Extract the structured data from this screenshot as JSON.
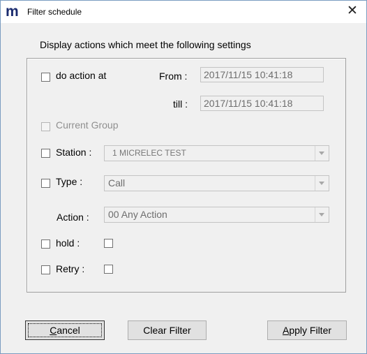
{
  "window": {
    "title": "Filter schedule",
    "app_icon": "m",
    "close_glyph": "✕"
  },
  "heading": "Display actions which  meet  the following settings",
  "do_action": {
    "label": "do action at",
    "from_label": "From :",
    "from_value": "2017/11/15  10:41:18",
    "till_label": "till :",
    "till_value": "2017/11/15  10:41:18"
  },
  "current_group": {
    "label": "Current Group"
  },
  "station": {
    "label": "Station :",
    "value": "1  MICRELEC TEST"
  },
  "type": {
    "label": "Type :",
    "value": "Call"
  },
  "action": {
    "label": "Action :",
    "value": "00  Any Action"
  },
  "hold": {
    "label": "hold :"
  },
  "retry": {
    "label": "Retry :"
  },
  "buttons": {
    "cancel_key": "C",
    "cancel_rest": "ancel",
    "clear": "Clear Filter",
    "apply_key": "A",
    "apply_rest": "pply Filter"
  },
  "colors": {
    "frame_border": "#7a9cc0",
    "client_bg": "#f0f0f0",
    "disabled_text": "#8f8f8f",
    "icon": "#1a2b6e"
  },
  "icons": {
    "app": "m-logo-icon",
    "close": "close-icon",
    "dropdown": "chevron-down-icon"
  }
}
